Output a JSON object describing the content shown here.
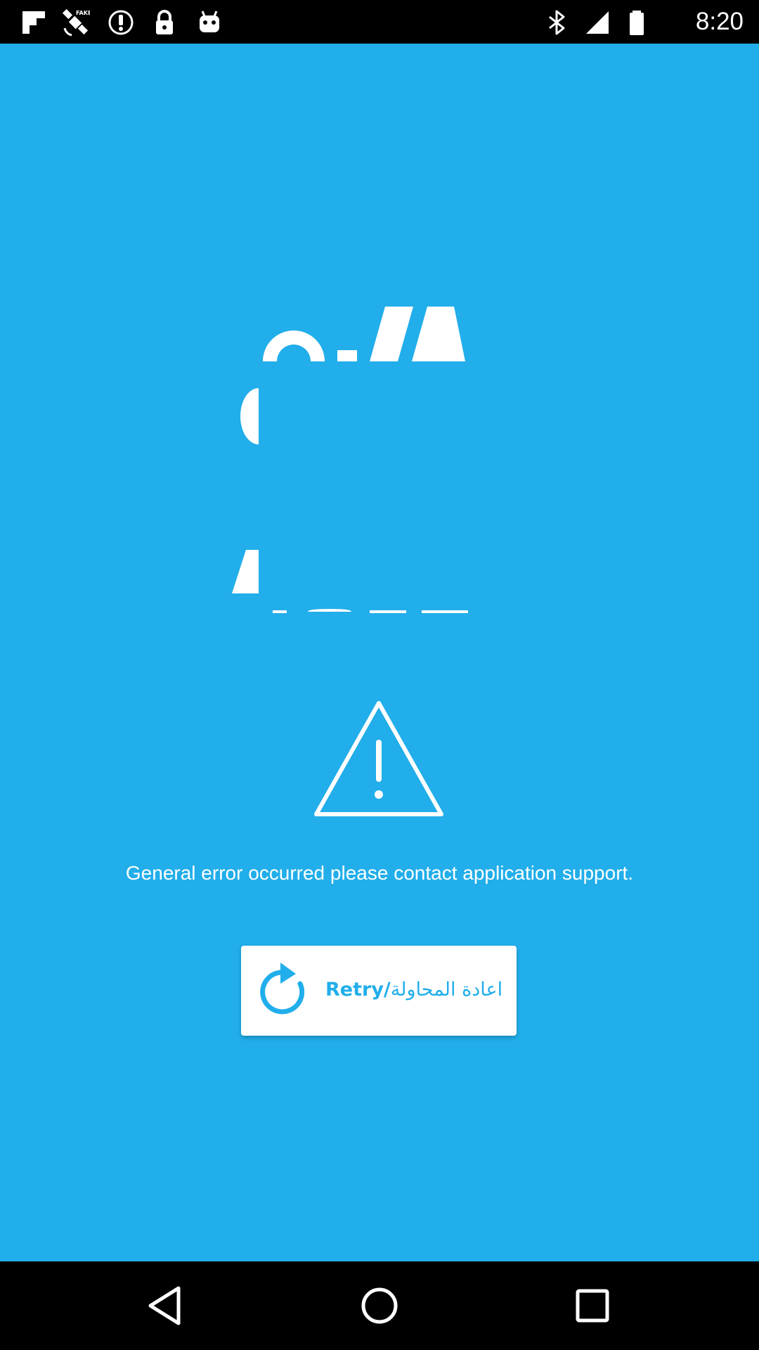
{
  "status_bar": {
    "time": "8:20",
    "left_icons": [
      "flipboard-icon",
      "fake-gps-satellite-icon",
      "info-circle-icon",
      "lock-icon",
      "android-icon"
    ],
    "right_icons": [
      "bluetooth-icon",
      "signal-icon",
      "battery-icon"
    ]
  },
  "main": {
    "error_message": "General error occurred please contact application support.",
    "retry_button": {
      "label_en": "Retry/",
      "label_ar": "اعادة المحاولة",
      "icon": "refresh-icon"
    },
    "warning_icon": "warning-triangle-icon"
  },
  "nav_bar": {
    "buttons": [
      "back-icon",
      "home-icon",
      "recents-icon"
    ]
  },
  "colors": {
    "background": "#21aeea",
    "button_background": "#ffffff",
    "button_text": "#21aeea",
    "text": "#ffffff",
    "bars": "#000000"
  }
}
